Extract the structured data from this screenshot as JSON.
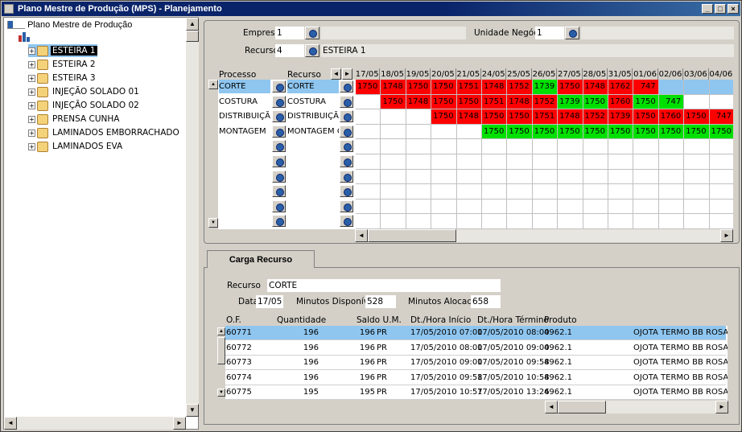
{
  "window": {
    "title": "Plano Mestre de Produção (MPS) - Planejamento"
  },
  "tree": {
    "root": "Plano Mestre de Produção",
    "items": [
      "ESTEIRA 1",
      "ESTEIRA 2",
      "ESTEIRA 3",
      "INJEÇÃO SOLADO 01",
      "INJEÇÃO SOLADO 02",
      "PRENSA CUNHA",
      "LAMINADOS EMBORRACHADO",
      "LAMINADOS EVA"
    ],
    "selected": 0
  },
  "filters": {
    "empresa_label": "Empresa",
    "empresa_value": "1",
    "unidade_label": "Unidade Negócio",
    "unidade_value": "1",
    "recurso_label": "Recurso",
    "recurso_value": "4",
    "recurso_name": "ESTEIRA 1"
  },
  "grid": {
    "col_processo": "Processo",
    "col_recurso": "Recurso",
    "dates": [
      "17/05",
      "18/05",
      "19/05",
      "20/05",
      "21/05",
      "24/05",
      "25/05",
      "26/05",
      "27/05",
      "28/05",
      "31/05",
      "01/06",
      "02/06",
      "03/06",
      "04/06"
    ],
    "rows": [
      {
        "processo": "CORTE",
        "recurso": "CORTE",
        "start": 0,
        "cells": [
          [
            "1750",
            "r"
          ],
          [
            "1748",
            "r"
          ],
          [
            "1750",
            "r"
          ],
          [
            "1750",
            "r"
          ],
          [
            "1751",
            "r"
          ],
          [
            "1748",
            "r"
          ],
          [
            "1752",
            "r"
          ],
          [
            "1739",
            "g"
          ],
          [
            "1750",
            "r"
          ],
          [
            "1748",
            "r"
          ],
          [
            "1762",
            "r"
          ],
          [
            "747",
            "r"
          ]
        ]
      },
      {
        "processo": "COSTURA",
        "recurso": "COSTURA",
        "start": 1,
        "cells": [
          [
            "1750",
            "r"
          ],
          [
            "1748",
            "r"
          ],
          [
            "1750",
            "r"
          ],
          [
            "1750",
            "r"
          ],
          [
            "1751",
            "r"
          ],
          [
            "1748",
            "r"
          ],
          [
            "1752",
            "r"
          ],
          [
            "1739",
            "g"
          ],
          [
            "1750",
            "g"
          ],
          [
            "1760",
            "r"
          ],
          [
            "1750",
            "g"
          ],
          [
            "747",
            "g"
          ]
        ]
      },
      {
        "processo": "DISTRIBUIÇÃO",
        "recurso": "DISTRIBUIÇÃO",
        "start": 3,
        "cells": [
          [
            "1750",
            "r"
          ],
          [
            "1748",
            "r"
          ],
          [
            "1750",
            "r"
          ],
          [
            "1750",
            "r"
          ],
          [
            "1751",
            "r"
          ],
          [
            "1748",
            "r"
          ],
          [
            "1752",
            "r"
          ],
          [
            "1739",
            "r"
          ],
          [
            "1750",
            "r"
          ],
          [
            "1760",
            "r"
          ],
          [
            "1750",
            "r"
          ],
          [
            "747",
            "r"
          ]
        ]
      },
      {
        "processo": "MONTAGEM",
        "recurso": "MONTAGEM CH",
        "start": 5,
        "cells": [
          [
            "1750",
            "g"
          ],
          [
            "1750",
            "g"
          ],
          [
            "1750",
            "g"
          ],
          [
            "1750",
            "g"
          ],
          [
            "1750",
            "g"
          ],
          [
            "1750",
            "g"
          ],
          [
            "1750",
            "g"
          ],
          [
            "1750",
            "g"
          ],
          [
            "1750",
            "g"
          ],
          [
            "1750",
            "g"
          ]
        ]
      }
    ]
  },
  "tab": {
    "label": "Carga Recurso"
  },
  "carga": {
    "recurso_label": "Recurso",
    "recurso_value": "CORTE",
    "data_label": "Data",
    "data_value": "17/05",
    "min_disp_label": "Minutos Disponíveis",
    "min_disp_value": "528",
    "min_aloc_label": "Minutos Alocados",
    "min_aloc_value": "658",
    "columns": [
      "O.F.",
      "Quantidade",
      "Saldo U.M.",
      "Dt./Hora Início",
      "Dt./Hora Término",
      "Produto"
    ],
    "rows": [
      {
        "of": "60771",
        "qtd": "196",
        "saldo": "196",
        "um": "PR",
        "inicio": "17/05/2010 07:00",
        "termino": "17/05/2010 08:00",
        "produto": "4962.1",
        "desc": "OJOTA TERMO BB ROSA"
      },
      {
        "of": "60772",
        "qtd": "196",
        "saldo": "196",
        "um": "PR",
        "inicio": "17/05/2010 08:00",
        "termino": "17/05/2010 09:00",
        "produto": "4962.1",
        "desc": "OJOTA TERMO BB ROSA"
      },
      {
        "of": "60773",
        "qtd": "196",
        "saldo": "196",
        "um": "PR",
        "inicio": "17/05/2010 09:00",
        "termino": "17/05/2010 09:58",
        "produto": "4962.1",
        "desc": "OJOTA TERMO BB ROSA"
      },
      {
        "of": "60774",
        "qtd": "196",
        "saldo": "196",
        "um": "PR",
        "inicio": "17/05/2010 09:58",
        "termino": "17/05/2010 10:58",
        "produto": "4962.1",
        "desc": "OJOTA TERMO BB ROSA"
      },
      {
        "of": "60775",
        "qtd": "195",
        "saldo": "195",
        "um": "PR",
        "inicio": "17/05/2010 10:57",
        "termino": "17/05/2010 13:26",
        "produto": "4962.1",
        "desc": "OJOTA TERMO BB ROSA"
      }
    ]
  },
  "colors": {
    "over": "#ff0000",
    "ok": "#00e000",
    "selected": "#8ec6f0"
  }
}
